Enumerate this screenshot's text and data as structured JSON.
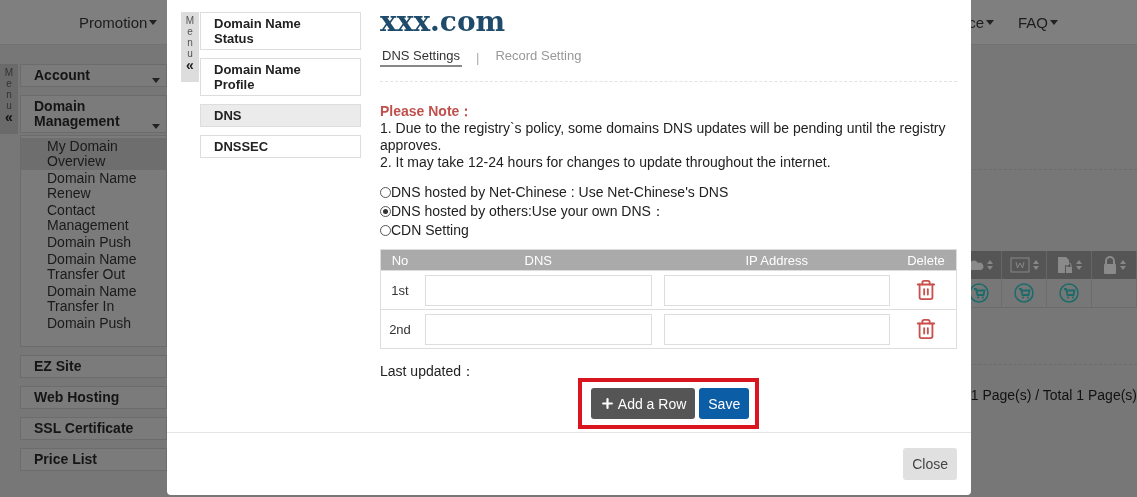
{
  "page": {
    "nav_items": [
      {
        "label": "Promotion"
      },
      {
        "label": "ce"
      },
      {
        "label": "FAQ"
      }
    ],
    "menu_tab": {
      "label": "Menu",
      "collapse": "«"
    },
    "sidebar": [
      {
        "label": "Account",
        "kind": "dropdown"
      },
      {
        "label": "Domain Management",
        "kind": "dropdown",
        "children": [
          {
            "label": "My Domain Overview",
            "selected": true
          },
          {
            "label": "Domain Name Renew",
            "selected": false
          },
          {
            "label": "Contact Management",
            "selected": false
          },
          {
            "label": "Domain Push",
            "selected": false
          },
          {
            "label": "Domain Name Transfer Out",
            "selected": false
          },
          {
            "label": "Domain Name Transfer In",
            "selected": false
          },
          {
            "label": "Domain Push",
            "selected": false
          }
        ]
      },
      {
        "label": "EZ Site",
        "kind": "link"
      },
      {
        "label": "Web Hosting",
        "kind": "link"
      },
      {
        "label": "SSL Certificate",
        "kind": "link"
      },
      {
        "label": "Price List",
        "kind": "link"
      }
    ],
    "pagination": "1 Page(s) / Total 1 Page(s)"
  },
  "dialog": {
    "menu_tab": {
      "label": "Menu",
      "collapse": "«"
    },
    "nav": [
      {
        "label": "Domain Name Status",
        "selected": false
      },
      {
        "label": "Domain Name Profile",
        "selected": false
      },
      {
        "label": "DNS",
        "selected": true
      },
      {
        "label": "DNSSEC",
        "selected": false
      }
    ],
    "title": "xxx.com",
    "tabs": [
      {
        "label": "DNS Settings",
        "selected": true
      },
      {
        "label": "Record Setting",
        "selected": false
      }
    ],
    "tab_separator": "|",
    "note_title": "Please Note：",
    "note_lines": [
      "1. Due to the registry`s policy, some domains DNS updates will be pending until the registry approves.",
      "2. It may take 12-24 hours for changes to update throughout the internet."
    ],
    "dns_options": [
      {
        "label": "DNS hosted by Net-Chinese : Use Net-Chinese's DNS",
        "selected": false
      },
      {
        "label": "DNS hosted by others:Use your own DNS：",
        "selected": true
      },
      {
        "label": "CDN Setting",
        "selected": false
      }
    ],
    "table": {
      "columns": [
        "No",
        "DNS",
        "IP Address",
        "Delete"
      ],
      "rows": [
        {
          "no": "1st"
        },
        {
          "no": "2nd"
        }
      ]
    },
    "last_updated": "Last updated：",
    "buttons": [
      {
        "label": "Add a Row",
        "kind": "add"
      },
      {
        "label": "Save",
        "kind": "primary"
      }
    ],
    "close": "Close"
  }
}
